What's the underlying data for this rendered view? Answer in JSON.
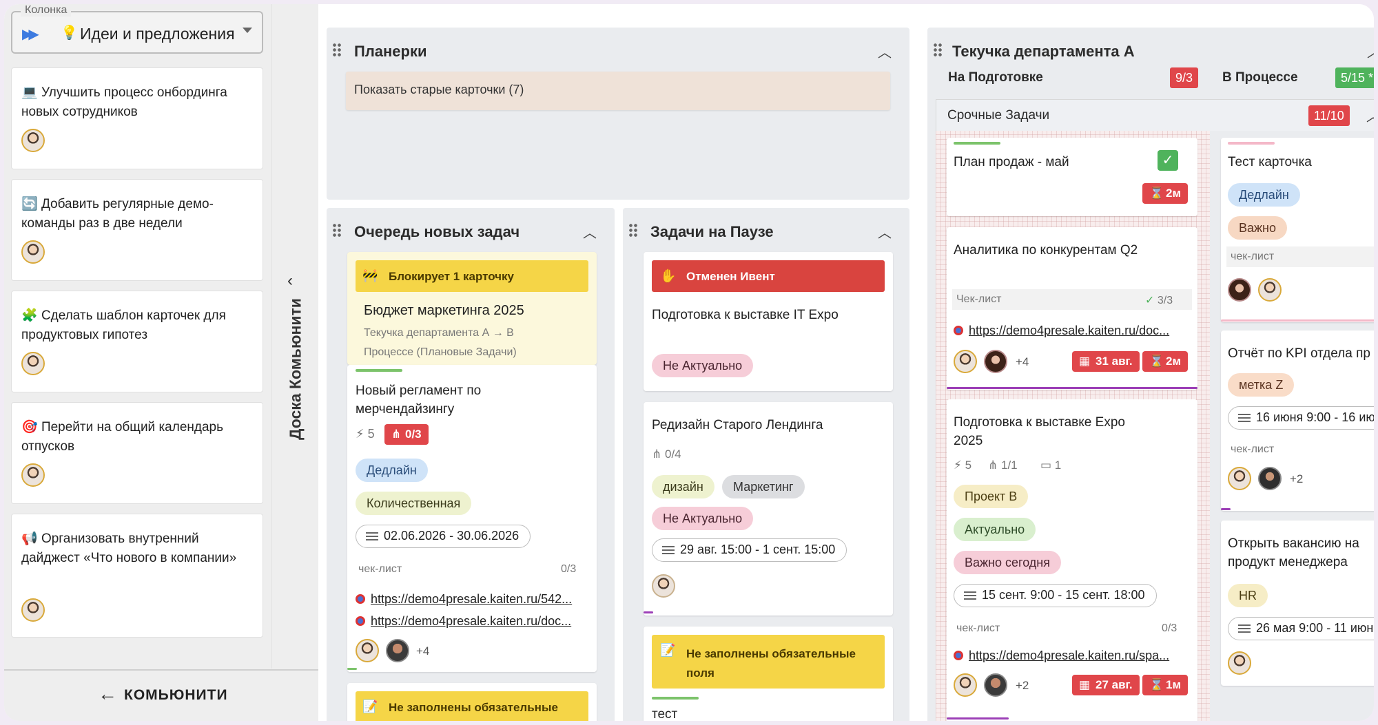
{
  "column_select": {
    "legend": "Колонка",
    "icon": "fast-forward-icon",
    "emoji": "💡",
    "value": "Идеи и предложения"
  },
  "left_cards": [
    {
      "emoji": "💻",
      "title": "Улучшить процесс онбординга новых сотрудников"
    },
    {
      "emoji": "🔄",
      "title": "Добавить регулярные демо-команды раз в две недели"
    },
    {
      "emoji": "🧩",
      "title": "Сделать шаблон карточек для продуктовых гипотез"
    },
    {
      "emoji": "🎯",
      "title": "Перейти на общий календарь отпусков"
    },
    {
      "emoji": "📢",
      "title": "Организовать внутренний дайджест «Что нового в компании»"
    }
  ],
  "side_strip": {
    "label": "Доска Комьюнити"
  },
  "community_button": {
    "label": "КОМЬЮНИТИ"
  },
  "lanes": {
    "planerki": {
      "title": "Планерки",
      "show_old": "Показать старые карточки (7)"
    },
    "queue": {
      "title": "Очередь новых задач",
      "card1": {
        "banner": "Блокирует 1 карточку",
        "title": "Бюджет маркетинга 2025",
        "subtitle": "Текучка департамента А → В Процессе (Плановые Задачи)"
      },
      "card2": {
        "title": "Новый регламент по мерчендайзингу",
        "priority": "5",
        "subtasks": "0/3",
        "tags": [
          "Дедлайн",
          "Количественная"
        ],
        "dates": "02.06.2026 - 30.06.2026",
        "checklist_label": "чек-лист",
        "checklist_count": "0/3",
        "links": [
          "https://demo4presale.kaiten.ru/542...",
          "https://demo4presale.kaiten.ru/doc..."
        ],
        "more": "+4"
      },
      "card3": {
        "banner": "Не заполнены обязательные"
      }
    },
    "pause": {
      "title": "Задачи на Паузе",
      "card1": {
        "banner": "Отменен Ивент",
        "title": "Подготовка к выставке IT Expo",
        "tag": "Не Актуально"
      },
      "card2": {
        "title": "Редизайн Старого Лендинга",
        "subtasks": "0/4",
        "tags": [
          "дизайн",
          "Маркетинг",
          "Не Актуально"
        ],
        "dates": "29 авг. 15:00 - 1 сент. 15:00"
      },
      "card3": {
        "banner": "Не заполнены обязательные поля",
        "title": "тест"
      }
    },
    "tekuchka": {
      "title": "Текучка департамента А",
      "col1": {
        "title": "На Подготовке",
        "count": "9/3"
      },
      "col2": {
        "title": "В Процессе",
        "count": "5/15 *"
      },
      "swimlane": {
        "title": "Срочные Задачи",
        "count": "11/10"
      },
      "cards_a": [
        {
          "title": "План продаж - май",
          "timer": "2м"
        },
        {
          "title": "Аналитика по конкурентам Q2",
          "checklist_label": "Чек-лист",
          "checklist_count": "3/3",
          "link": "https://demo4presale.kaiten.ru/doc...",
          "more": "+4",
          "date": "31 авг.",
          "timer": "2м"
        },
        {
          "title": "Подготовка к выставке Expo 2025",
          "priority": "5",
          "subtasks": "1/1",
          "comments": "1",
          "tags": [
            "Проект В",
            "Актуально",
            "Важно сегодня"
          ],
          "dates": "15 сент. 9:00 - 15 сент. 18:00",
          "checklist_label": "чек-лист",
          "checklist_count": "0/3",
          "link": "https://demo4presale.kaiten.ru/spa...",
          "more": "+2",
          "date": "27 авг.",
          "timer": "1м"
        }
      ],
      "cards_b": [
        {
          "title": "Тест карточка",
          "tags": [
            "Дедлайн",
            "Важно"
          ],
          "checklist_label": "чек-лист"
        },
        {
          "title": "Отчёт по KPI отдела пр",
          "tag": "метка Z",
          "dates": "16 июня 9:00 - 16 ию",
          "checklist_label": "чек-лист",
          "more": "+2"
        },
        {
          "title": "Открыть вакансию на продукт менеджера",
          "tag": "HR",
          "dates": "26 мая 9:00 - 11 июн"
        }
      ]
    }
  },
  "colors": {
    "accent_red": "#e0464a",
    "accent_green": "#4fb35c",
    "banner_yellow": "#f5d547",
    "banner_red": "#d9443f"
  }
}
